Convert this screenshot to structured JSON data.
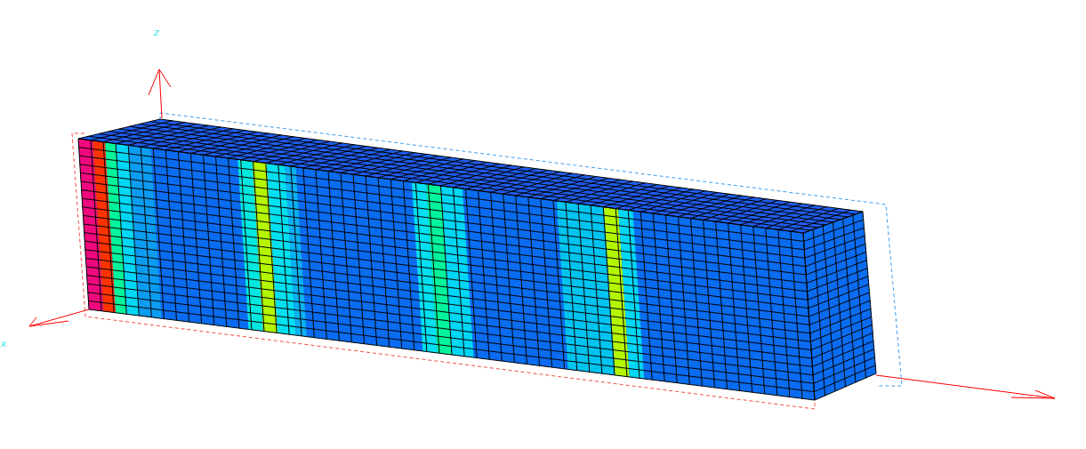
{
  "axes": [
    {
      "label": "z"
    },
    {
      "label": "x"
    }
  ]
}
